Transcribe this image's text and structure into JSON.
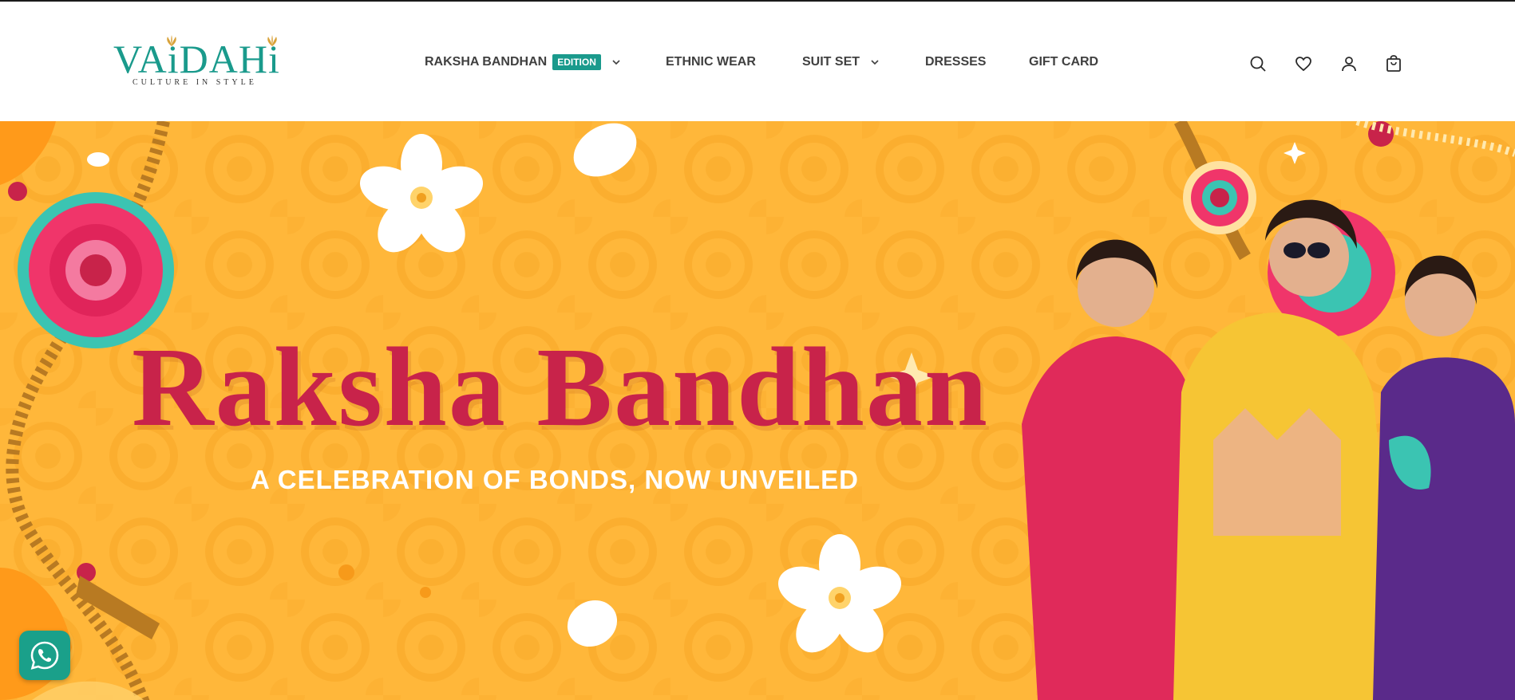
{
  "brand": {
    "logo_text": "VAiDAHi",
    "tagline": "CULTURE IN STYLE",
    "accent_color": "#1a9a8c"
  },
  "nav": {
    "items": [
      {
        "label": "RAKSHA BANDHAN",
        "badge": "EDITION",
        "has_dropdown": true
      },
      {
        "label": "ETHNIC WEAR",
        "has_dropdown": false
      },
      {
        "label": "SUIT SET",
        "has_dropdown": true
      },
      {
        "label": "DRESSES",
        "has_dropdown": false
      },
      {
        "label": "GIFT CARD",
        "has_dropdown": false
      }
    ]
  },
  "header_icons": [
    "search-icon",
    "wishlist-heart-icon",
    "account-icon",
    "cart-bag-icon"
  ],
  "hero": {
    "title": "Raksha Bandhan",
    "subtitle": "A CELEBRATION OF BONDS, NOW UNVEILED",
    "background_color": "#ffb73a",
    "title_color": "#c8234a"
  },
  "floating": {
    "whatsapp_icon": "whatsapp-icon",
    "whatsapp_color": "#1aa08a"
  }
}
